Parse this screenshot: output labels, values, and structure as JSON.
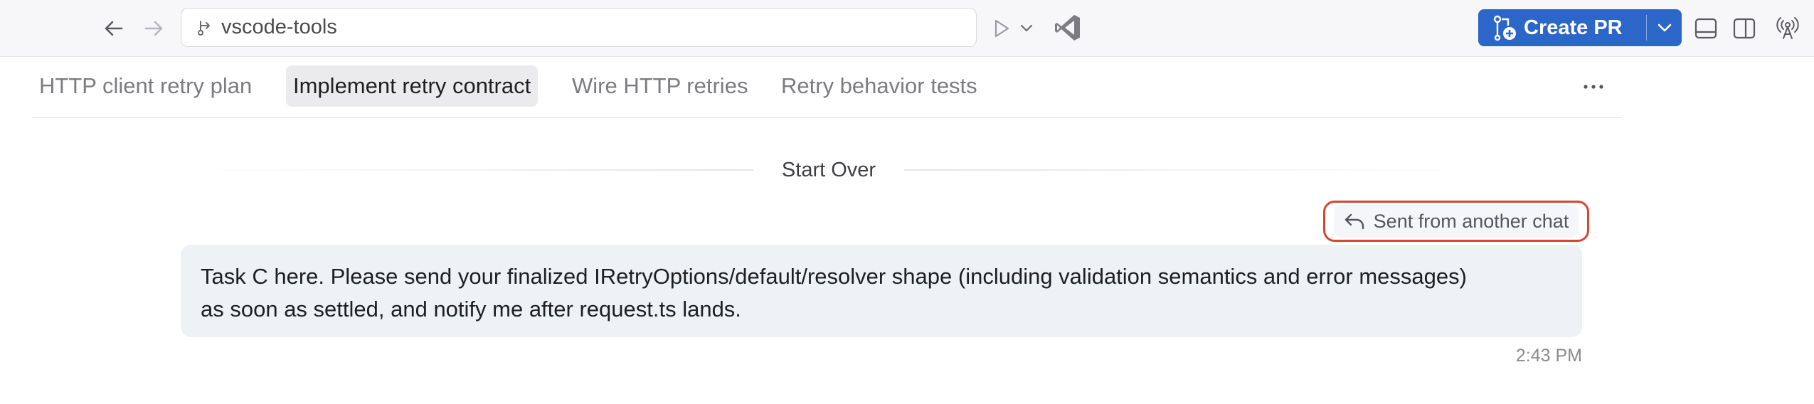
{
  "toolbar": {
    "back_icon": "arrow-left-icon",
    "forward_icon": "arrow-right-icon",
    "address": {
      "icon": "branch-icon",
      "text": "vscode-tools"
    },
    "run_icon": "play-icon",
    "run_dropdown_icon": "chevron-down-icon",
    "vscode_icon": "vscode-icon",
    "create_pr": {
      "icon": "pull-request-add-icon",
      "label": "Create PR",
      "dropdown_icon": "chevron-down-icon",
      "color": "#2c66c9"
    },
    "layout_icons": [
      "panel-bottom-icon",
      "split-editor-icon",
      "broadcast-icon"
    ]
  },
  "tabs": [
    {
      "label": "HTTP client retry plan",
      "active": false
    },
    {
      "label": "Implement retry contract",
      "active": true
    },
    {
      "label": "Wire HTTP retries",
      "active": false
    },
    {
      "label": "Retry behavior tests",
      "active": false
    }
  ],
  "more_icon": "ellipsis-icon",
  "conversation": {
    "divider_label": "Start Over",
    "sent_badge": {
      "icon": "reply-icon",
      "label": "Sent from another chat",
      "highlight_color": "#d9452f"
    },
    "message": {
      "line1": "Task C here. Please send your finalized IRetryOptions/default/resolver shape (including validation semantics and error messages)",
      "line2": "as soon as settled, and notify me after request.ts lands."
    },
    "timestamp": "2:43 PM"
  }
}
